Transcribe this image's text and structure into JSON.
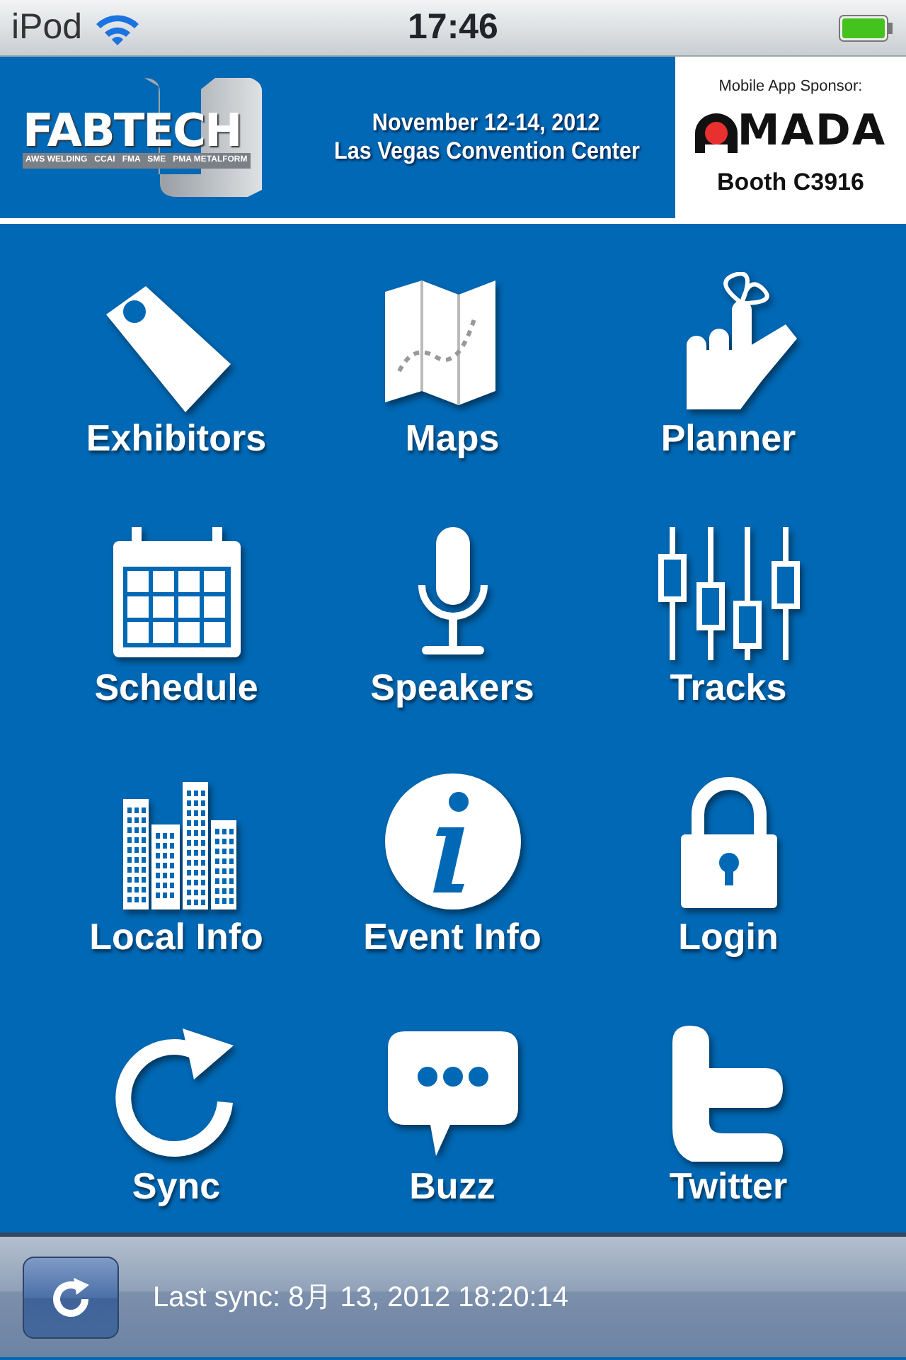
{
  "status_bar": {
    "carrier": "iPod",
    "time": "17:46"
  },
  "header": {
    "logo": {
      "name": "FABTECH",
      "tagline": "AWS WELDING   CCAI   FMA   SME   PMA METALFORM"
    },
    "dates": "November 12-14, 2012",
    "venue": "Las Vegas Convention Center",
    "sponsor": {
      "caption": "Mobile App Sponsor:",
      "logo": "MADA",
      "booth": "Booth C3916"
    }
  },
  "menu": [
    {
      "label": "Exhibitors"
    },
    {
      "label": "Maps"
    },
    {
      "label": "Planner"
    },
    {
      "label": "Schedule"
    },
    {
      "label": "Speakers"
    },
    {
      "label": "Tracks"
    },
    {
      "label": "Local Info"
    },
    {
      "label": "Event Info"
    },
    {
      "label": "Login"
    },
    {
      "label": "Sync"
    },
    {
      "label": "Buzz"
    },
    {
      "label": "Twitter"
    }
  ],
  "footer": {
    "sync_label": "Last sync:",
    "sync_time": "8月 13, 2012 18:20:14"
  }
}
